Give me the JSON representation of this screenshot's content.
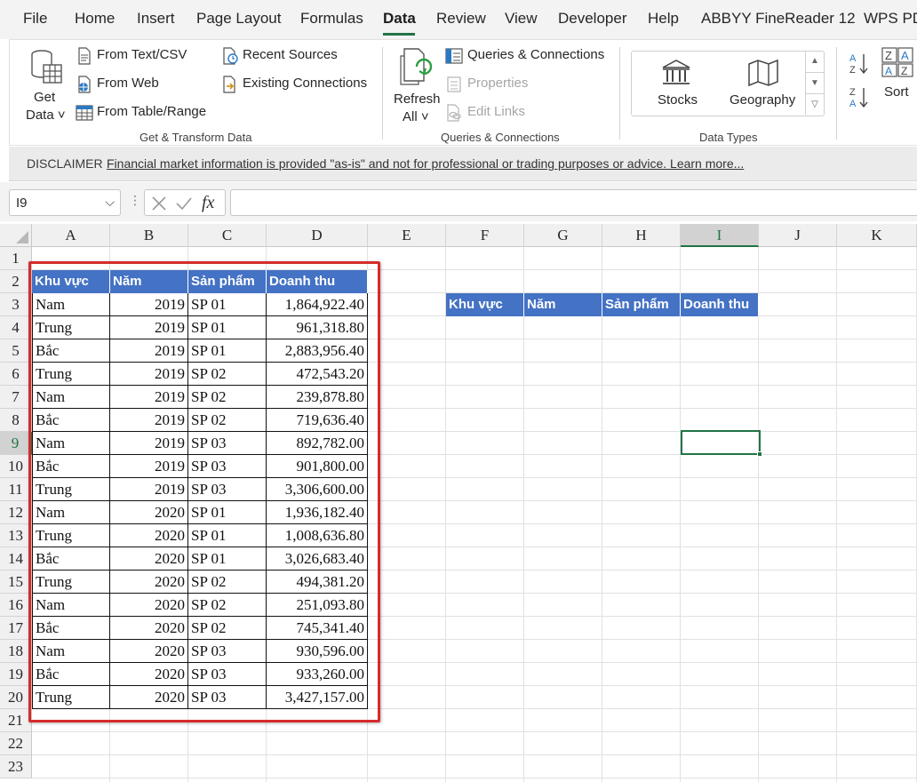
{
  "tabs": [
    "File",
    "Home",
    "Insert",
    "Page Layout",
    "Formulas",
    "Data",
    "Review",
    "View",
    "Developer",
    "Help",
    "ABBYY FineReader 12",
    "WPS PD"
  ],
  "active_tab": "Data",
  "ribbon": {
    "get_data": {
      "line1": "Get",
      "line2": "Data ˅"
    },
    "get_transform": {
      "from_text": "From Text/CSV",
      "from_web": "From Web",
      "from_table": "From Table/Range",
      "recent_sources": "Recent Sources",
      "existing_connections": "Existing Connections",
      "group_label": "Get & Transform Data"
    },
    "queries": {
      "refresh_line1": "Refresh",
      "refresh_line2": "All ˅",
      "queries_connections": "Queries & Connections",
      "properties": "Properties",
      "edit_links": "Edit Links",
      "group_label": "Queries & Connections"
    },
    "data_types": {
      "stocks": "Stocks",
      "geography": "Geography",
      "group_label": "Data Types"
    },
    "sort": {
      "label": "Sort"
    }
  },
  "disclaimer": {
    "title": "DISCLAIMER",
    "text": "Financial market information is provided \"as-is\" and not for professional or trading purposes or advice. Learn more..."
  },
  "formula_bar": {
    "name_box": "I9",
    "formula": ""
  },
  "columns": [
    "A",
    "B",
    "C",
    "D",
    "E",
    "F",
    "G",
    "H",
    "I",
    "J",
    "K"
  ],
  "selected_column": "I",
  "rows": [
    "1",
    "2",
    "3",
    "4",
    "5",
    "6",
    "7",
    "8",
    "9",
    "10",
    "11",
    "12",
    "13",
    "14",
    "15",
    "16",
    "17",
    "18",
    "19",
    "20",
    "21",
    "22",
    "23"
  ],
  "selected_row": "9",
  "table": {
    "headers": [
      "Khu vực",
      "Năm",
      "Sản phẩm",
      "Doanh thu"
    ],
    "rows": [
      [
        "Nam",
        "2019",
        "SP 01",
        "1,864,922.40"
      ],
      [
        "Trung",
        "2019",
        "SP 01",
        "961,318.80"
      ],
      [
        "Bắc",
        "2019",
        "SP 01",
        "2,883,956.40"
      ],
      [
        "Trung",
        "2019",
        "SP 02",
        "472,543.20"
      ],
      [
        "Nam",
        "2019",
        "SP 02",
        "239,878.80"
      ],
      [
        "Bắc",
        "2019",
        "SP 02",
        "719,636.40"
      ],
      [
        "Nam",
        "2019",
        "SP 03",
        "892,782.00"
      ],
      [
        "Bắc",
        "2019",
        "SP 03",
        "901,800.00"
      ],
      [
        "Trung",
        "2019",
        "SP 03",
        "3,306,600.00"
      ],
      [
        "Nam",
        "2020",
        "SP 01",
        "1,936,182.40"
      ],
      [
        "Trung",
        "2020",
        "SP 01",
        "1,008,636.80"
      ],
      [
        "Bắc",
        "2020",
        "SP 01",
        "3,026,683.40"
      ],
      [
        "Trung",
        "2020",
        "SP 02",
        "494,381.20"
      ],
      [
        "Nam",
        "2020",
        "SP 02",
        "251,093.80"
      ],
      [
        "Bắc",
        "2020",
        "SP 02",
        "745,341.40"
      ],
      [
        "Nam",
        "2020",
        "SP 03",
        "930,596.00"
      ],
      [
        "Bắc",
        "2020",
        "SP 03",
        "933,260.00"
      ],
      [
        "Trung",
        "2020",
        "SP 03",
        "3,427,157.00"
      ]
    ]
  },
  "criteria_headers": [
    "Khu vực",
    "Năm",
    "Sản phẩm",
    "Doanh thu"
  ],
  "colors": {
    "header_fill": "#4472c4",
    "accent_green": "#217346",
    "highlight_red": "#d62b2b"
  }
}
